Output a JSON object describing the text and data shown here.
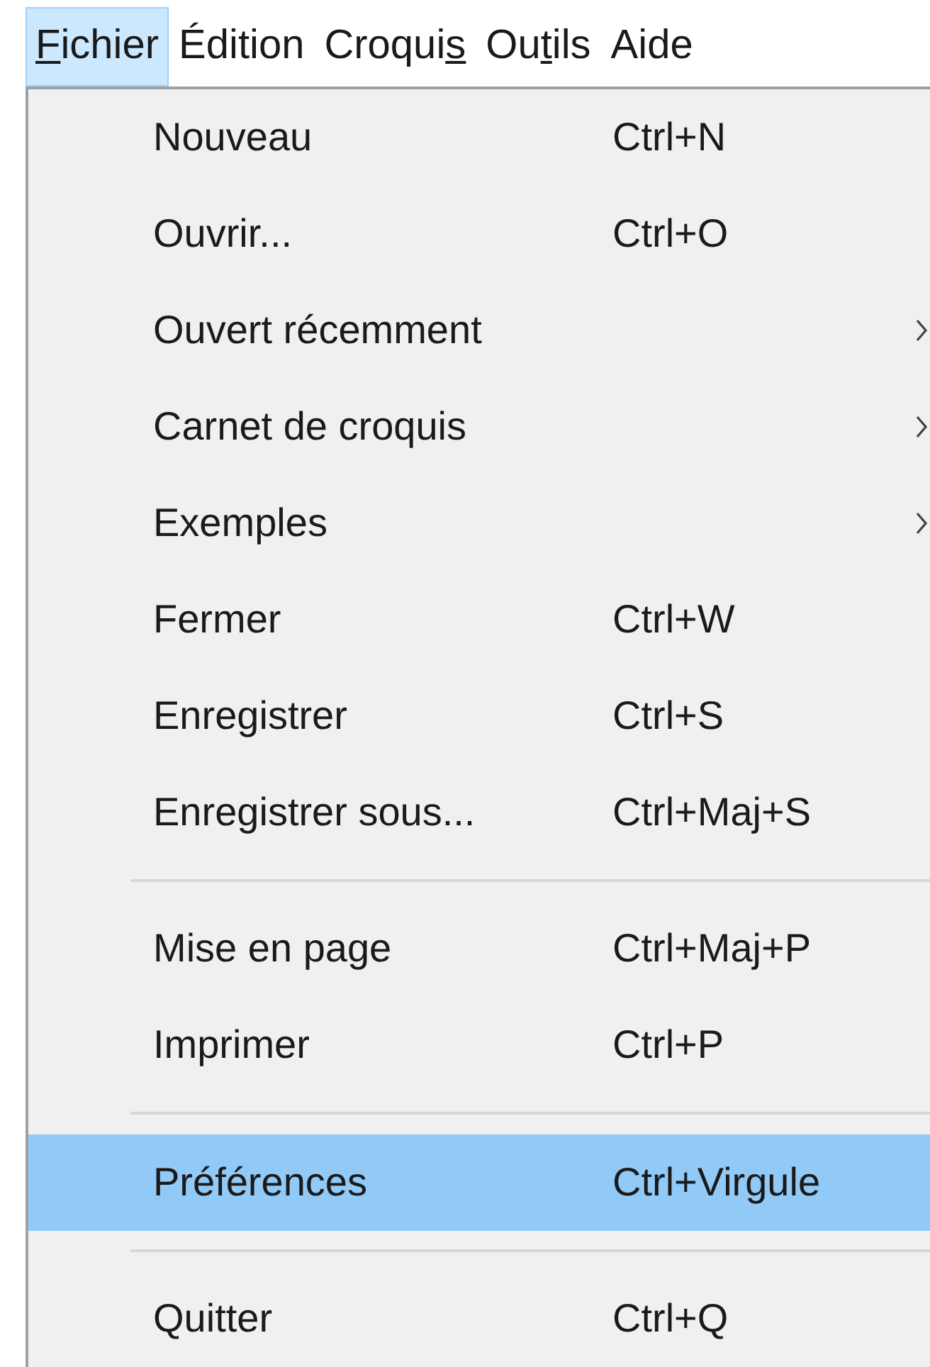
{
  "menu_bar": [
    {
      "label": {
        "mnemonic": "F",
        "after": "ichier"
      },
      "selected": true
    },
    {
      "label": {
        "before": "Édition"
      },
      "selected": false
    },
    {
      "label": {
        "before": "Croqui",
        "mnemonic": "s"
      },
      "selected": false
    },
    {
      "label": {
        "before": "Ou",
        "mnemonic": "t",
        "after": "ils"
      },
      "selected": false
    },
    {
      "label": {
        "before": "Aide"
      },
      "selected": false
    }
  ],
  "menu": {
    "items": [
      {
        "kind": "item",
        "label": "Nouveau",
        "shortcut": "Ctrl+N",
        "selected": false
      },
      {
        "kind": "item",
        "label": "Ouvrir...",
        "shortcut": "Ctrl+O",
        "selected": false
      },
      {
        "kind": "submenu",
        "label": "Ouvert récemment",
        "selected": false
      },
      {
        "kind": "submenu",
        "label": "Carnet de croquis",
        "selected": false
      },
      {
        "kind": "submenu",
        "label": "Exemples",
        "selected": false
      },
      {
        "kind": "item",
        "label": "Fermer",
        "shortcut": "Ctrl+W",
        "selected": false
      },
      {
        "kind": "item",
        "label": "Enregistrer",
        "shortcut": "Ctrl+S",
        "selected": false
      },
      {
        "kind": "item",
        "label": "Enregistrer sous...",
        "shortcut": "Ctrl+Maj+S",
        "selected": false
      },
      {
        "kind": "separator"
      },
      {
        "kind": "item",
        "label": "Mise en page",
        "shortcut": "Ctrl+Maj+P",
        "selected": false
      },
      {
        "kind": "item",
        "label": "Imprimer",
        "shortcut": "Ctrl+P",
        "selected": false
      },
      {
        "kind": "separator"
      },
      {
        "kind": "item",
        "label": "Préférences",
        "shortcut": "Ctrl+Virgule",
        "selected": true
      },
      {
        "kind": "separator"
      },
      {
        "kind": "item",
        "label": "Quitter",
        "shortcut": "Ctrl+Q",
        "selected": false
      }
    ]
  }
}
